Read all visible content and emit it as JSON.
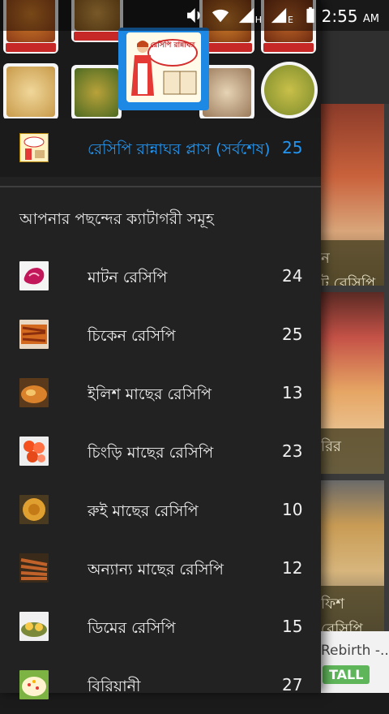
{
  "status_bar": {
    "time": "2:55",
    "ampm": "AM",
    "network_label": "H",
    "network_label_2": "E"
  },
  "background": {
    "card_captions": [
      "ন\nট রেসিপি",
      "রির",
      "ফিশ\nরেসিপি"
    ],
    "ad_title": "Rebirth -...",
    "ad_button": "TALL"
  },
  "drawer": {
    "logo_text": "রেসিপি রান্নাঘর",
    "featured": {
      "label": "রেসিপি রান্নাঘর প্লাস (সর্বশেষ)",
      "count": "25"
    },
    "section_title": "আপনার পছন্দের ক্যাটাগরী সমূহ",
    "categories": [
      {
        "label": "মাটন রেসিপি",
        "count": "24",
        "icon": "mutton-icon"
      },
      {
        "label": "চিকেন রেসিপি",
        "count": "25",
        "icon": "chicken-icon"
      },
      {
        "label": "ইলিশ মাছের রেসিপি",
        "count": "13",
        "icon": "hilsa-fish-icon"
      },
      {
        "label": "চিংড়ি মাছের রেসিপি",
        "count": "23",
        "icon": "prawn-icon"
      },
      {
        "label": "রুই মাছের রেসিপি",
        "count": "10",
        "icon": "rui-fish-icon"
      },
      {
        "label": "অন্যান্য মাছের রেসিপি",
        "count": "12",
        "icon": "other-fish-icon"
      },
      {
        "label": "ডিমের রেসিপি",
        "count": "15",
        "icon": "egg-icon"
      },
      {
        "label": "বিরিয়ানী",
        "count": "27",
        "icon": "biryani-icon"
      }
    ]
  },
  "colors": {
    "accent": "#2196f3",
    "drawer_bg": "#222222",
    "text": "#f0f0f0"
  }
}
